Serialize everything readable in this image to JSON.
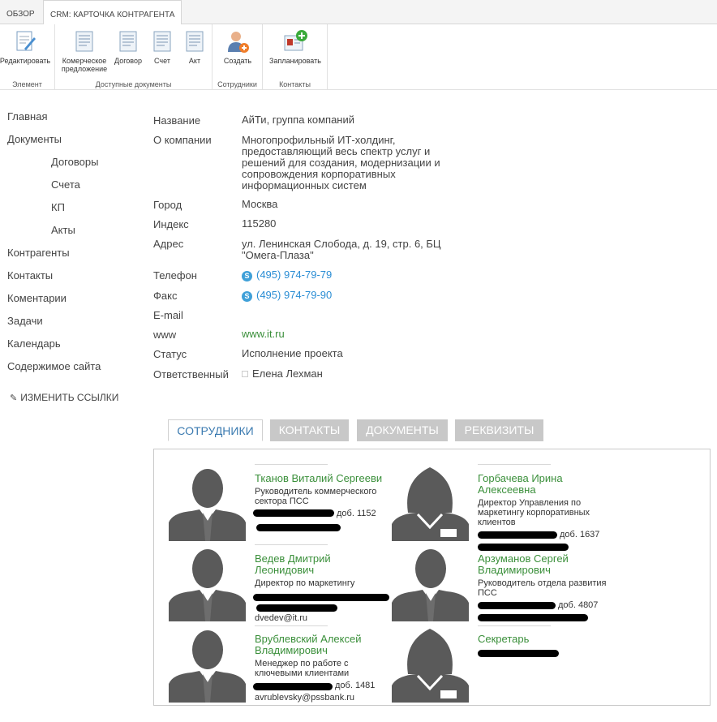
{
  "ribbon": {
    "tabs": [
      "ОБЗОР",
      "CRM: КАРТОЧКА КОНТРАГЕНТА"
    ],
    "groups": {
      "element": {
        "label": "Элемент",
        "buttons": [
          "Редактировать"
        ]
      },
      "docs": {
        "label": "Доступные документы",
        "buttons": [
          "Комерческое предложение",
          "Договор",
          "Счет",
          "Акт"
        ]
      },
      "staff": {
        "label": "Сотрудники",
        "buttons": [
          "Создать"
        ]
      },
      "contacts": {
        "label": "Контакты",
        "buttons": [
          "Запланировать"
        ]
      }
    }
  },
  "nav": {
    "items": [
      "Главная",
      "Документы",
      "Договоры",
      "Счета",
      "КП",
      "Акты",
      "Контрагенты",
      "Контакты",
      "Коментарии",
      "Задачи",
      "Календарь",
      "Содержимое сайта"
    ],
    "edit_links": "ИЗМЕНИТЬ ССЫЛКИ"
  },
  "props": {
    "name_label": "Название",
    "name": "АйТи, группа компаний",
    "about_label": "О компании",
    "about": [
      "Многопрофильный ИТ-холдинг,",
      "предоставляющий весь спектр услуг и",
      "решений для создания, модернизации и",
      "сопровождения корпоративных",
      "информационных систем"
    ],
    "city_label": "Город",
    "city": "Москва",
    "index_label": "Индекс",
    "index": "115280",
    "address_label": "Адрес",
    "address": [
      "ул. Ленинская Слобода, д. 19, стр. 6, БЦ",
      "\"Омега-Плаза\""
    ],
    "phone_label": "Телефон",
    "phone": "(495) 974-79-79",
    "fax_label": "Факс",
    "fax": "(495) 974-79-90",
    "email_label": "E-mail",
    "www_label": "www",
    "www": "www.it.ru",
    "status_label": "Статус",
    "status": "Исполнение проекта",
    "resp_label": "Ответственный",
    "resp": "Елена Лехман"
  },
  "subtabs": [
    "СОТРУДНИКИ",
    "КОНТАКТЫ",
    "ДОКУМЕНТЫ",
    "РЕКВИЗИТЫ"
  ],
  "employees": {
    "e1": {
      "name": "Тканов Виталий Сергееви",
      "title": [
        "Руководитель коммерческого",
        "сектора ПСС"
      ],
      "ext": "доб. 1152"
    },
    "e2": {
      "name": [
        "Горбачева Ирина",
        "Алексеевна"
      ],
      "title": [
        "Директор Управления по",
        "маркетингу корпоративных",
        "клиентов"
      ],
      "ext": "доб. 1637"
    },
    "e3": {
      "name": [
        "Ведев Дмитрий",
        "Леонидович"
      ],
      "title": [
        "Директор по маркетингу"
      ],
      "email": "dvedev@it.ru"
    },
    "e4": {
      "name": [
        "Арзуманов Сергей",
        "Владимирович"
      ],
      "title": [
        "Руководитель отдела развития",
        "ПСС"
      ],
      "ext": "доб. 4807"
    },
    "e5": {
      "name": [
        "Врублевский Алексей",
        "Владимирович"
      ],
      "title": [
        "Менеджер по работе с",
        "ключевыми клиентами"
      ],
      "ext": "доб. 1481",
      "email": "avrublevsky@pssbank.ru"
    },
    "e6": {
      "name": [
        "Секретарь"
      ]
    }
  },
  "colors": {
    "accent": "#3a8f3a",
    "link": "#2a8dd4",
    "tab_inactive": "#c8c8c8"
  }
}
